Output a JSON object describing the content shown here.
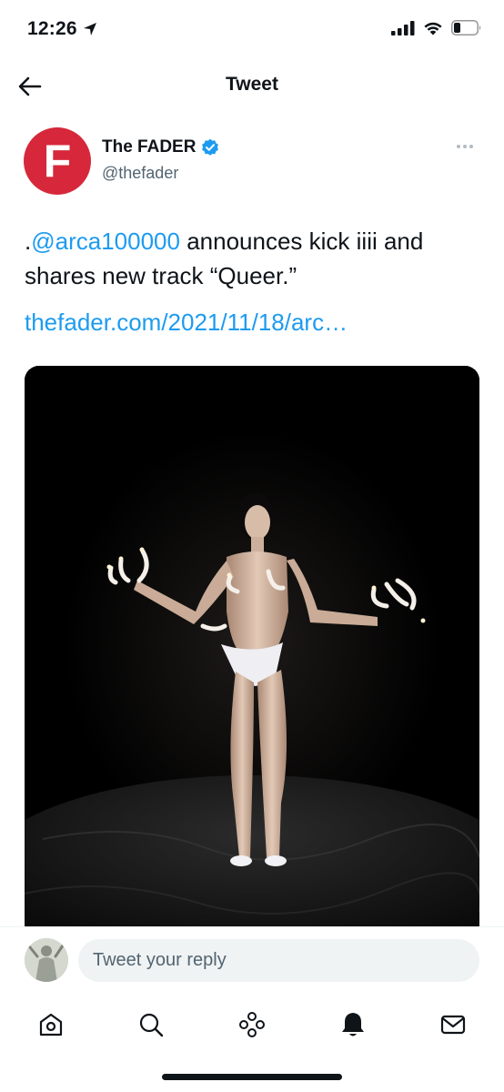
{
  "status_bar": {
    "time": "12:26"
  },
  "header": {
    "title": "Tweet"
  },
  "author": {
    "avatar_letter": "F",
    "name": "The FADER",
    "handle": "@thefader",
    "brand_color": "#d6283a",
    "verified_color": "#1d9bf0"
  },
  "tweet": {
    "prefix": ".",
    "mention": "@arca100000",
    "text_after_mention": " announces kick iiii and shares new track “Queer.”",
    "link": "thefader.com/2021/11/18/arc…"
  },
  "reply": {
    "placeholder": "Tweet your reply"
  },
  "bottom_nav": {
    "items": [
      "home-icon",
      "search-icon",
      "spaces-icon",
      "notifications-icon",
      "messages-icon"
    ]
  }
}
